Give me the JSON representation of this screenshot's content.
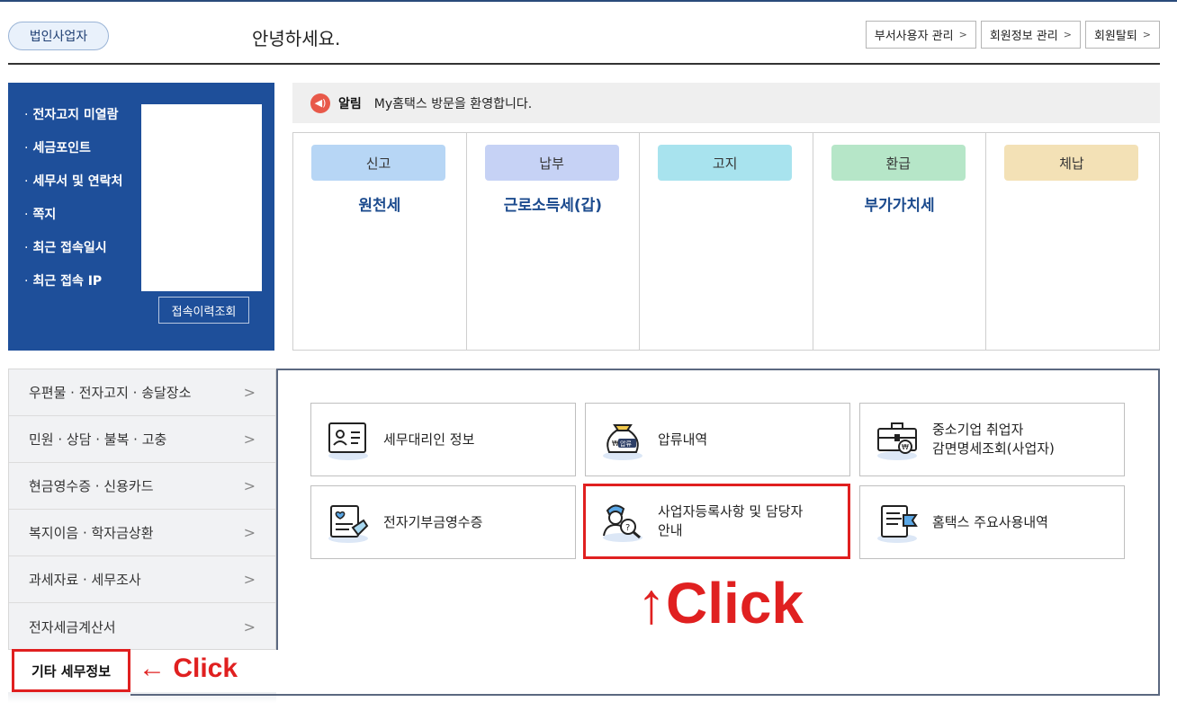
{
  "header": {
    "badge": "법인사업자",
    "greeting": "안녕하세요.",
    "buttons": [
      "부서사용자 관리",
      "회원정보 관리",
      "회원탈퇴"
    ]
  },
  "info": {
    "items": [
      "전자고지 미열람",
      "세금포인트",
      "세무서 및 연락처",
      "쪽지",
      "최근 접속일시",
      "최근 접속 IP"
    ],
    "history_button": "접속이력조회"
  },
  "notice": {
    "icon": "megaphone-icon",
    "title": "알림",
    "text": "My홈택스 방문을 환영합니다."
  },
  "categories": [
    {
      "label": "신고",
      "sub": "원천세",
      "color": "#b7d6f5"
    },
    {
      "label": "납부",
      "sub": "근로소득세(갑)",
      "color": "#c6d2f5"
    },
    {
      "label": "고지",
      "sub": "",
      "color": "#a8e3ee"
    },
    {
      "label": "환급",
      "sub": "부가가치세",
      "color": "#b6e6c8"
    },
    {
      "label": "체납",
      "sub": "",
      "color": "#f3e1b6"
    }
  ],
  "menu": {
    "items": [
      "우편물 · 전자고지 · 송달장소",
      "민원 · 상담 · 불복 · 고충",
      "현금영수증 · 신용카드",
      "복지이음 · 학자금상환",
      "과세자료 · 세무조사",
      "전자세금계산서"
    ],
    "active": "기타 세무정보"
  },
  "services": [
    {
      "label": "세무대리인 정보",
      "icon": "id-card-icon"
    },
    {
      "label": "압류내역",
      "icon": "seizure-bag-icon",
      "icon_text": "압류"
    },
    {
      "label": "중소기업 취업자\n감면명세조회(사업자)",
      "icon": "briefcase-icon"
    },
    {
      "label": "전자기부금영수증",
      "icon": "donation-receipt-icon"
    },
    {
      "label": "사업자등록사항 및 담당자\n안내",
      "icon": "user-search-icon"
    },
    {
      "label": "홈택스 주요사용내역",
      "icon": "document-flag-icon"
    }
  ],
  "annotations": {
    "big": "↑Click",
    "small": "← Click"
  },
  "colors": {
    "accent_red": "#e02020",
    "navy": "#1e4f9a"
  }
}
